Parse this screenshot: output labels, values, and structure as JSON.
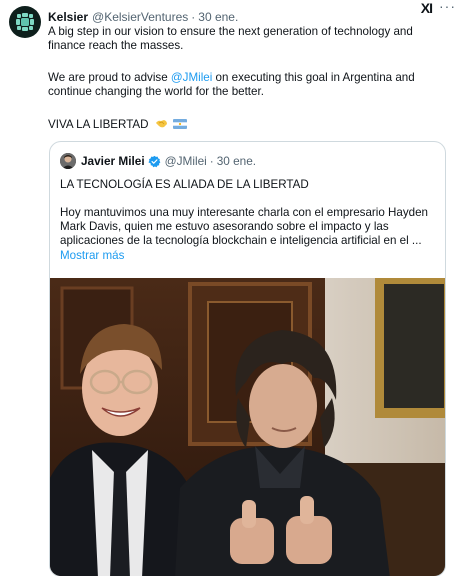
{
  "tweet": {
    "author_name": "Kelsier",
    "author_handle": "@KelsierVentures",
    "separator": "·",
    "date": "30 ene.",
    "grok_label": "XI",
    "more_label": "···",
    "paragraph1": "A big step in our vision to ensure the next generation of technology and finance reach the masses.",
    "paragraph2_before": "We are proud to advise ",
    "paragraph2_mention": "@JMilei",
    "paragraph2_after": " on executing this goal in Argentina and continue changing the world for the better.",
    "paragraph3": "VIVA LA LIBERTAD"
  },
  "quote": {
    "author_name": "Javier Milei",
    "author_handle": "@JMilei",
    "separator": "·",
    "date": "30 ene.",
    "title": "LA TECNOLOGÍA ES ALIADA DE LA LIBERTAD",
    "body": "Hoy mantuvimos una muy interesante charla con el empresario Hayden Mark Davis, quien me estuvo asesorando sobre el impacto y las aplicaciones de la tecnología blockchain e inteligencia artificial en el ...",
    "show_more": "Mostrar más"
  },
  "colors": {
    "link": "#1d9bf0",
    "secondary_text": "#536471",
    "border": "#cfd9de",
    "verified_badge": "#1d9bf0"
  }
}
